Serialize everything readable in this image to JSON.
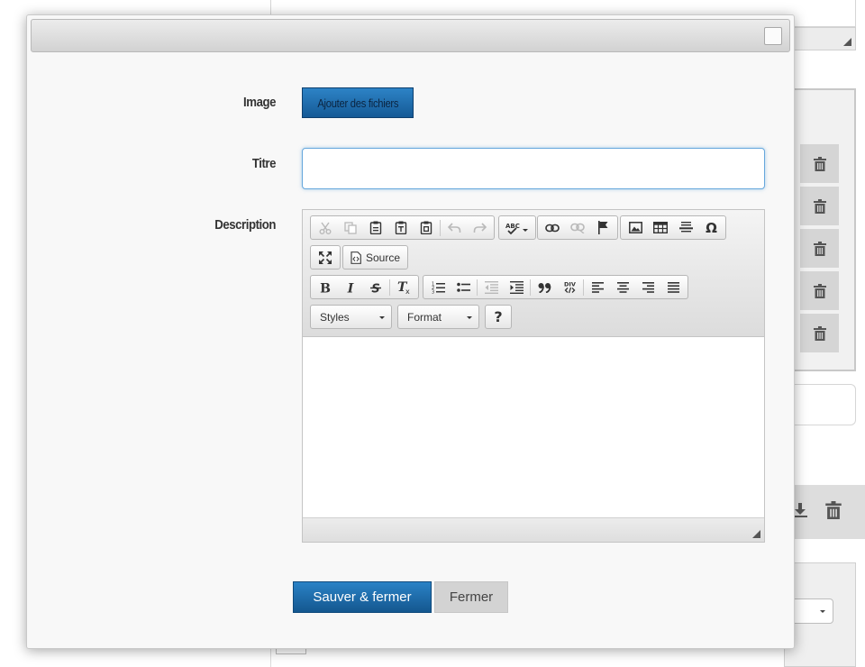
{
  "dialog": {
    "fields": {
      "image_label": "Image",
      "titre_label": "Titre",
      "description_label": "Description"
    },
    "add_files_button": "Ajouter des fichiers",
    "titre_input": {
      "value": "",
      "placeholder": ""
    },
    "editor": {
      "toolbar_row1": [
        "cut-icon",
        "copy-icon",
        "paste-icon",
        "paste-text-icon",
        "paste-word-icon",
        "undo-icon",
        "redo-icon",
        "spellcheck-icon",
        "link-icon",
        "unlink-icon",
        "anchor-flag-icon",
        "image-icon",
        "table-icon",
        "horizontal-rule-icon",
        "special-char-icon"
      ],
      "maximize_icon": "maximize-icon",
      "source_label": "Source",
      "toolbar_row3": [
        "bold-icon",
        "italic-icon",
        "strike-icon",
        "remove-format-icon",
        "numbered-list-icon",
        "bulleted-list-icon",
        "outdent-icon",
        "indent-icon",
        "blockquote-icon",
        "div-icon",
        "align-left-icon",
        "align-center-icon",
        "align-right-icon",
        "justify-icon"
      ],
      "styles_combo": "Styles",
      "format_combo": "Format",
      "help_label": "?",
      "content": ""
    },
    "buttons": {
      "save_close": "Sauver & fermer",
      "close": "Fermer"
    }
  },
  "colors": {
    "primary_blue": "#1f6eb0",
    "focus_blue": "#66a7dc",
    "neutral_button": "#d3d3d3"
  }
}
